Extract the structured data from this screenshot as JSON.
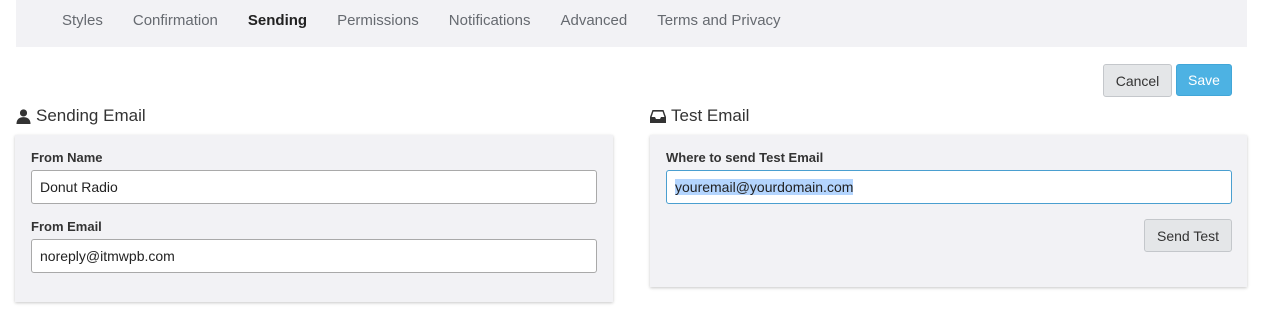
{
  "tabs": [
    {
      "label": "Styles"
    },
    {
      "label": "Confirmation"
    },
    {
      "label": "Sending",
      "active": true
    },
    {
      "label": "Permissions"
    },
    {
      "label": "Notifications"
    },
    {
      "label": "Advanced"
    },
    {
      "label": "Terms and Privacy"
    }
  ],
  "actions": {
    "cancel_label": "Cancel",
    "save_label": "Save"
  },
  "sending_email": {
    "title": "Sending Email",
    "icon": "user-icon",
    "from_name": {
      "label": "From Name",
      "value": "Donut Radio"
    },
    "from_email": {
      "label": "From Email",
      "value": "noreply@itmwpb.com"
    }
  },
  "test_email": {
    "title": "Test Email",
    "icon": "inbox-icon",
    "recipient": {
      "label": "Where to send Test Email",
      "value": "youremail@yourdomain.com"
    },
    "send_label": "Send Test"
  },
  "colors": {
    "accent": "#4db2e3",
    "panel_bg": "#f2f2f5",
    "selection": "#b4d5fe"
  }
}
